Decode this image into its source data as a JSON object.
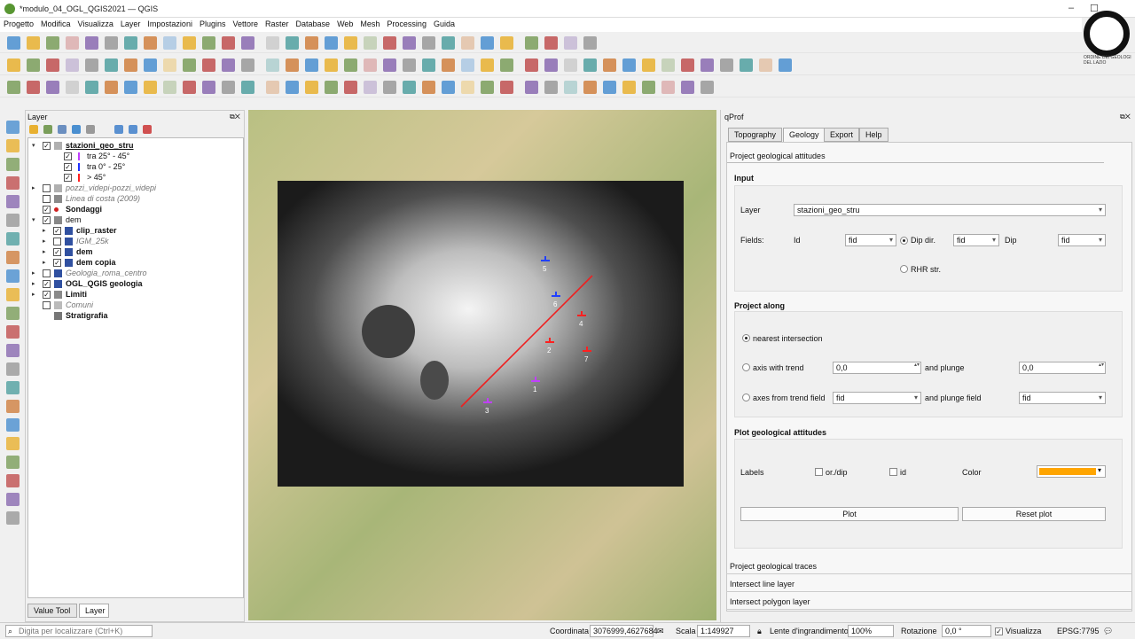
{
  "window": {
    "title": "*modulo_04_OGL_QGIS2021 — QGIS",
    "min": "–",
    "max": "☐",
    "close": "✕"
  },
  "menu": [
    "Progetto",
    "Modifica",
    "Visualizza",
    "Layer",
    "Impostazioni",
    "Plugins",
    "Vettore",
    "Raster",
    "Database",
    "Web",
    "Mesh",
    "Processing",
    "Guida"
  ],
  "layer_panel": {
    "title": "Layer",
    "tabs": [
      "Value Tool",
      "Layer"
    ],
    "active_tab": "Layer",
    "items": [
      {
        "label": "stazioni_geo_stru",
        "style": "b",
        "underline": true,
        "arrow": "▾",
        "checked": true,
        "indent": 0,
        "icon": "points"
      },
      {
        "label": "tra 25° -  45°",
        "indent": 2,
        "checked": true,
        "color": "#c040ff",
        "arrow": ""
      },
      {
        "label": "tra 0° - 25°",
        "indent": 2,
        "checked": true,
        "color": "#2030ff",
        "arrow": ""
      },
      {
        "label": "> 45°",
        "indent": 2,
        "checked": true,
        "color": "#ff2020",
        "arrow": ""
      },
      {
        "label": "pozzi_videpi-pozzi_videpi",
        "style": "it",
        "checked": false,
        "indent": 0,
        "arrow": "▸",
        "icon": "points"
      },
      {
        "label": "Linea di costa (2009)",
        "style": "it",
        "checked": false,
        "indent": 0,
        "arrow": "",
        "icon": "line"
      },
      {
        "label": "Sondaggi",
        "style": "b",
        "checked": true,
        "indent": 0,
        "arrow": "",
        "icon": "dot"
      },
      {
        "label": "dem",
        "checked": true,
        "indent": 0,
        "arrow": "▾",
        "icon": "group"
      },
      {
        "label": "clip_raster",
        "style": "b",
        "checked": true,
        "indent": 1,
        "arrow": "▸",
        "icon": "raster"
      },
      {
        "label": "IGM_25k",
        "style": "it",
        "checked": false,
        "indent": 1,
        "arrow": "▸",
        "icon": "raster"
      },
      {
        "label": "dem",
        "style": "b",
        "checked": true,
        "indent": 1,
        "arrow": "▸",
        "icon": "raster"
      },
      {
        "label": "dem copia",
        "style": "b",
        "checked": true,
        "indent": 1,
        "arrow": "▸",
        "icon": "raster"
      },
      {
        "label": "Geologia_roma_centro",
        "style": "it",
        "checked": false,
        "indent": 0,
        "arrow": "▸",
        "icon": "raster"
      },
      {
        "label": "OGL_QGIS geologia",
        "style": "b",
        "checked": true,
        "indent": 0,
        "arrow": "▸",
        "icon": "raster"
      },
      {
        "label": "Limiti",
        "style": "b",
        "checked": true,
        "indent": 0,
        "arrow": "▸",
        "icon": "line"
      },
      {
        "label": "Comuni",
        "style": "it",
        "checked": false,
        "indent": 0,
        "arrow": "",
        "icon": "poly"
      },
      {
        "label": "Stratigrafia",
        "style": "b",
        "checked": null,
        "indent": 0,
        "arrow": "",
        "icon": "table"
      }
    ]
  },
  "map": {
    "points": [
      {
        "id": "5",
        "color": "#2040ff"
      },
      {
        "id": "6",
        "color": "#2040ff"
      },
      {
        "id": "4",
        "color": "#ff2020"
      },
      {
        "id": "2",
        "color": "#ff2020"
      },
      {
        "id": "7",
        "color": "#ff2020"
      },
      {
        "id": "1",
        "color": "#c040ff"
      },
      {
        "id": "3",
        "color": "#c040ff"
      }
    ]
  },
  "qprof": {
    "title": "qProf",
    "tabs": [
      "Topography",
      "Geology",
      "Export",
      "Help"
    ],
    "active_tab": "Geology",
    "section_title": "Project geological attitudes",
    "input": {
      "title": "Input",
      "layer_label": "Layer",
      "layer_value": "stazioni_geo_stru",
      "fields_label": "Fields:",
      "id_label": "Id",
      "id_value": "fid",
      "dipdir_label": "Dip dir.",
      "dipdir_value": "fid",
      "dip_label": "Dip",
      "dip_value": "fid",
      "rhr_label": "RHR str."
    },
    "project_along": {
      "title": "Project along",
      "nearest": "nearest intersection",
      "axis_trend": "axis with trend",
      "trend_value": "0,0",
      "and_plunge": "and plunge",
      "plunge_value": "0,0",
      "axes_field": "axes from trend field",
      "trend_field_value": "fid",
      "plunge_field": "and plunge field",
      "plunge_field_value": "fid"
    },
    "plot": {
      "title": "Plot geological attitudes",
      "labels": "Labels",
      "ordip": "or./dip",
      "id": "id",
      "color_label": "Color",
      "color": "#ffa500",
      "plot_btn": "Plot",
      "reset_btn": "Reset plot"
    },
    "collapsed": [
      "Project geological traces",
      "Intersect line layer",
      "Intersect polygon layer"
    ]
  },
  "status": {
    "search_placeholder": "Digita per localizzare (Ctrl+K)",
    "coord_label": "Coordinata",
    "coord_value": "3076999,4627684",
    "scale_label": "Scala",
    "scale_value": "1:149927",
    "magnifier_label": "Lente d'ingrandimento",
    "magnifier_value": "100%",
    "rotation_label": "Rotazione",
    "rotation_value": "0,0 °",
    "render_label": "Visualizza",
    "crs": "EPSG:7795"
  },
  "logo": {
    "text": "ORDINE DEI GEOLOGI DEL LAZIO"
  }
}
